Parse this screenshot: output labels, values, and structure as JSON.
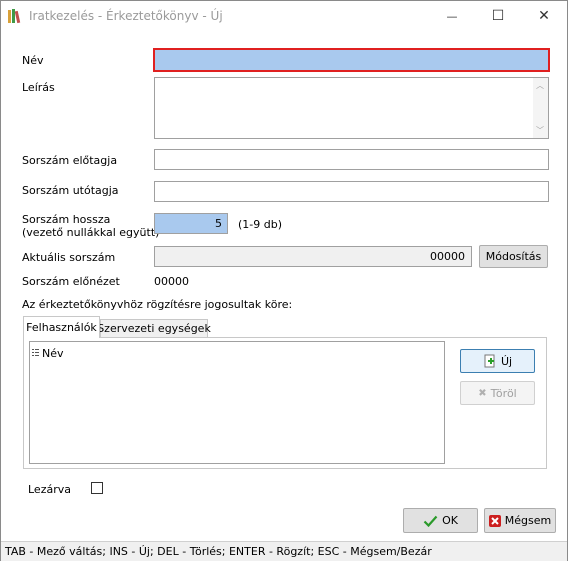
{
  "window": {
    "title": "Iratkezelés - Érkeztetőkönyv - Új",
    "minimize_glyph": "—",
    "maximize_glyph": "☐",
    "close_glyph": "✕"
  },
  "form": {
    "nev_label": "Név",
    "nev_value": "",
    "leiras_label": "Leírás",
    "leiras_value": "",
    "elotag_label": "Sorszám előtagja",
    "elotag_value": "",
    "utotag_label": "Sorszám utótagja",
    "utotag_value": "",
    "hossz_label_line1": "Sorszám hossza",
    "hossz_label_line2": "(vezető nullákkal együtt)",
    "hossz_value": "5",
    "hossz_hint": "(1-9 db)",
    "aktualis_label": "Aktuális sorszám",
    "aktualis_value": "00000",
    "modositas_button": "Módosítás",
    "elonezet_label": "Sorszám előnézet",
    "elonezet_value": "00000",
    "jogosultak_label": "Az érkeztetőkönyvhöz rögzítésre jogosultak köre:",
    "lezarva_label": "Lezárva",
    "lezarva_checked": false
  },
  "tabs": [
    {
      "label": "Felhasználók",
      "active": true
    },
    {
      "label": "Szervezeti egységek",
      "active": false
    }
  ],
  "list": {
    "column_header": "Név",
    "rows": []
  },
  "buttons": {
    "new_label": "Új",
    "delete_label": "Töröl",
    "ok_label": "OK",
    "cancel_label": "Mégsem"
  },
  "statusbar": {
    "text": "TAB - Mező váltás; INS - Új; DEL - Törlés; ENTER - Rögzít; ESC - Mégsem/Bezár"
  },
  "colors": {
    "active_field_fill": "#a9c9ee",
    "active_field_border": "#e02020",
    "ok_check": "#2a9a2a",
    "cancel_x": "#cc1f1f",
    "add_plus": "#2aa02a"
  }
}
